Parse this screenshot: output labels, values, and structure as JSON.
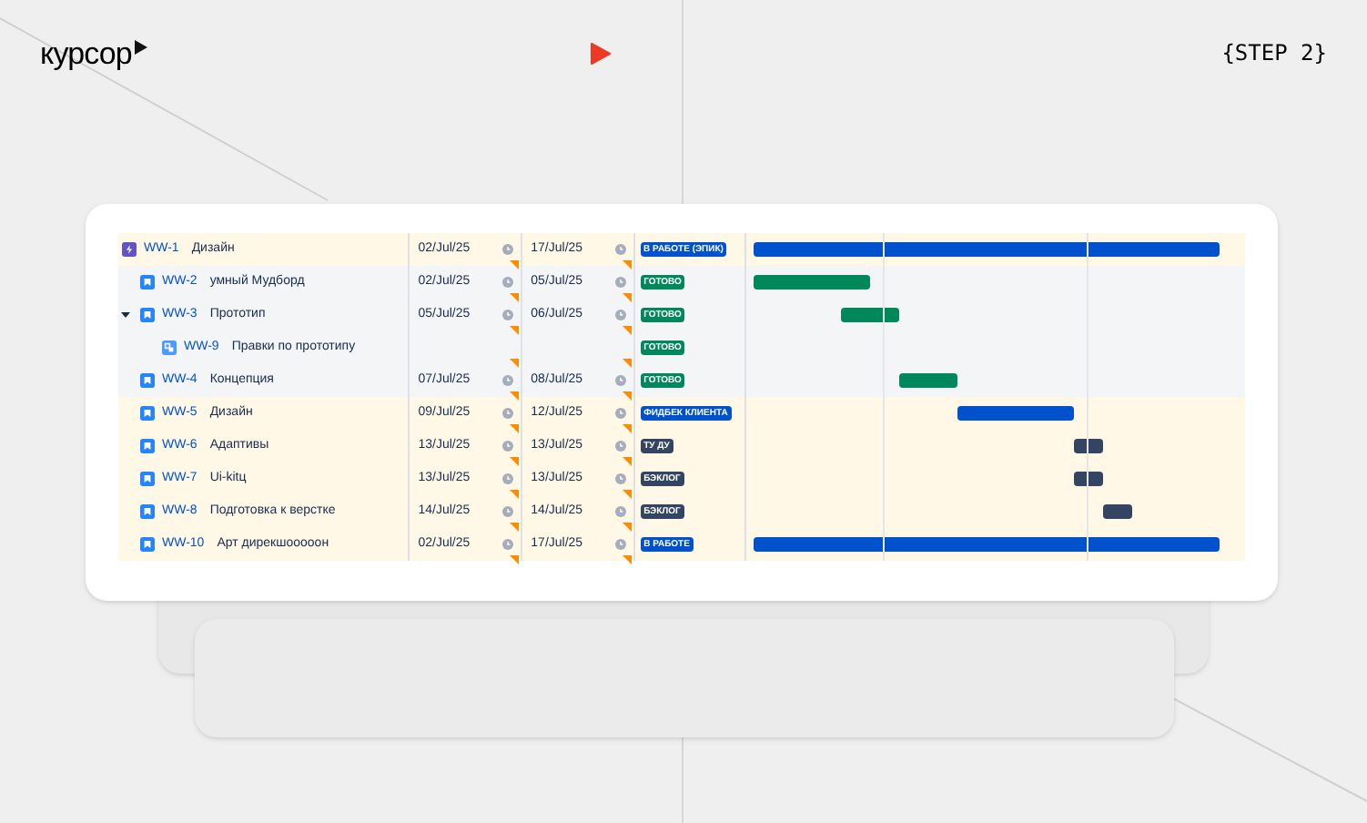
{
  "header": {
    "logo": "курсор",
    "step": "{STEP 2}"
  },
  "rows": [
    {
      "key": "WW-1",
      "summary": "Дизайн",
      "kind": "epic",
      "highlighted": true,
      "start": "02/Jul/25",
      "due": "17/Jul/25",
      "status": {
        "label": "В РАБОТЕ (ЭПИК)",
        "kind": "in_progress"
      }
    },
    {
      "key": "WW-2",
      "summary": "умный Мудборд",
      "kind": "story",
      "highlighted": false,
      "start": "02/Jul/25",
      "due": "05/Jul/25",
      "status": {
        "label": "ГОТОВО",
        "kind": "done"
      }
    },
    {
      "key": "WW-3",
      "summary": "Прототип",
      "kind": "story",
      "highlighted": false,
      "expanded": true,
      "start": "05/Jul/25",
      "due": "06/Jul/25",
      "status": {
        "label": "ГОТОВО",
        "kind": "done"
      },
      "children": [
        {
          "key": "WW-9",
          "summary": "Правки по прототипу",
          "kind": "subtask",
          "highlighted": false,
          "status": {
            "label": "ГОТОВО",
            "kind": "done"
          }
        }
      ]
    },
    {
      "key": "WW-4",
      "summary": "Концепция",
      "kind": "story",
      "highlighted": false,
      "start": "07/Jul/25",
      "due": "08/Jul/25",
      "status": {
        "label": "ГОТОВО",
        "kind": "done"
      }
    },
    {
      "key": "WW-5",
      "summary": "Дизайн",
      "kind": "story",
      "highlighted": true,
      "start": "09/Jul/25",
      "due": "12/Jul/25",
      "status": {
        "label": "ФИДБЕК КЛИЕНТА",
        "kind": "in_progress"
      }
    },
    {
      "key": "WW-6",
      "summary": "Адаптивы",
      "kind": "story",
      "highlighted": true,
      "start": "13/Jul/25",
      "due": "13/Jul/25",
      "status": {
        "label": "ТУ ДУ",
        "kind": "todo"
      }
    },
    {
      "key": "WW-7",
      "summary": "Ui-kitц",
      "kind": "story",
      "highlighted": true,
      "start": "13/Jul/25",
      "due": "13/Jul/25",
      "status": {
        "label": "БЭКЛОГ",
        "kind": "todo"
      }
    },
    {
      "key": "WW-8",
      "summary": "Подготовка к верстке",
      "kind": "story",
      "highlighted": true,
      "start": "14/Jul/25",
      "due": "14/Jul/25",
      "status": {
        "label": "БЭКЛОГ",
        "kind": "todo"
      }
    },
    {
      "key": "WW-10",
      "summary": "Арт дирекшооооон",
      "kind": "story",
      "highlighted": true,
      "start": "02/Jul/25",
      "due": "17/Jul/25",
      "status": {
        "label": "В РАБОТЕ",
        "kind": "in_progress"
      }
    }
  ]
}
